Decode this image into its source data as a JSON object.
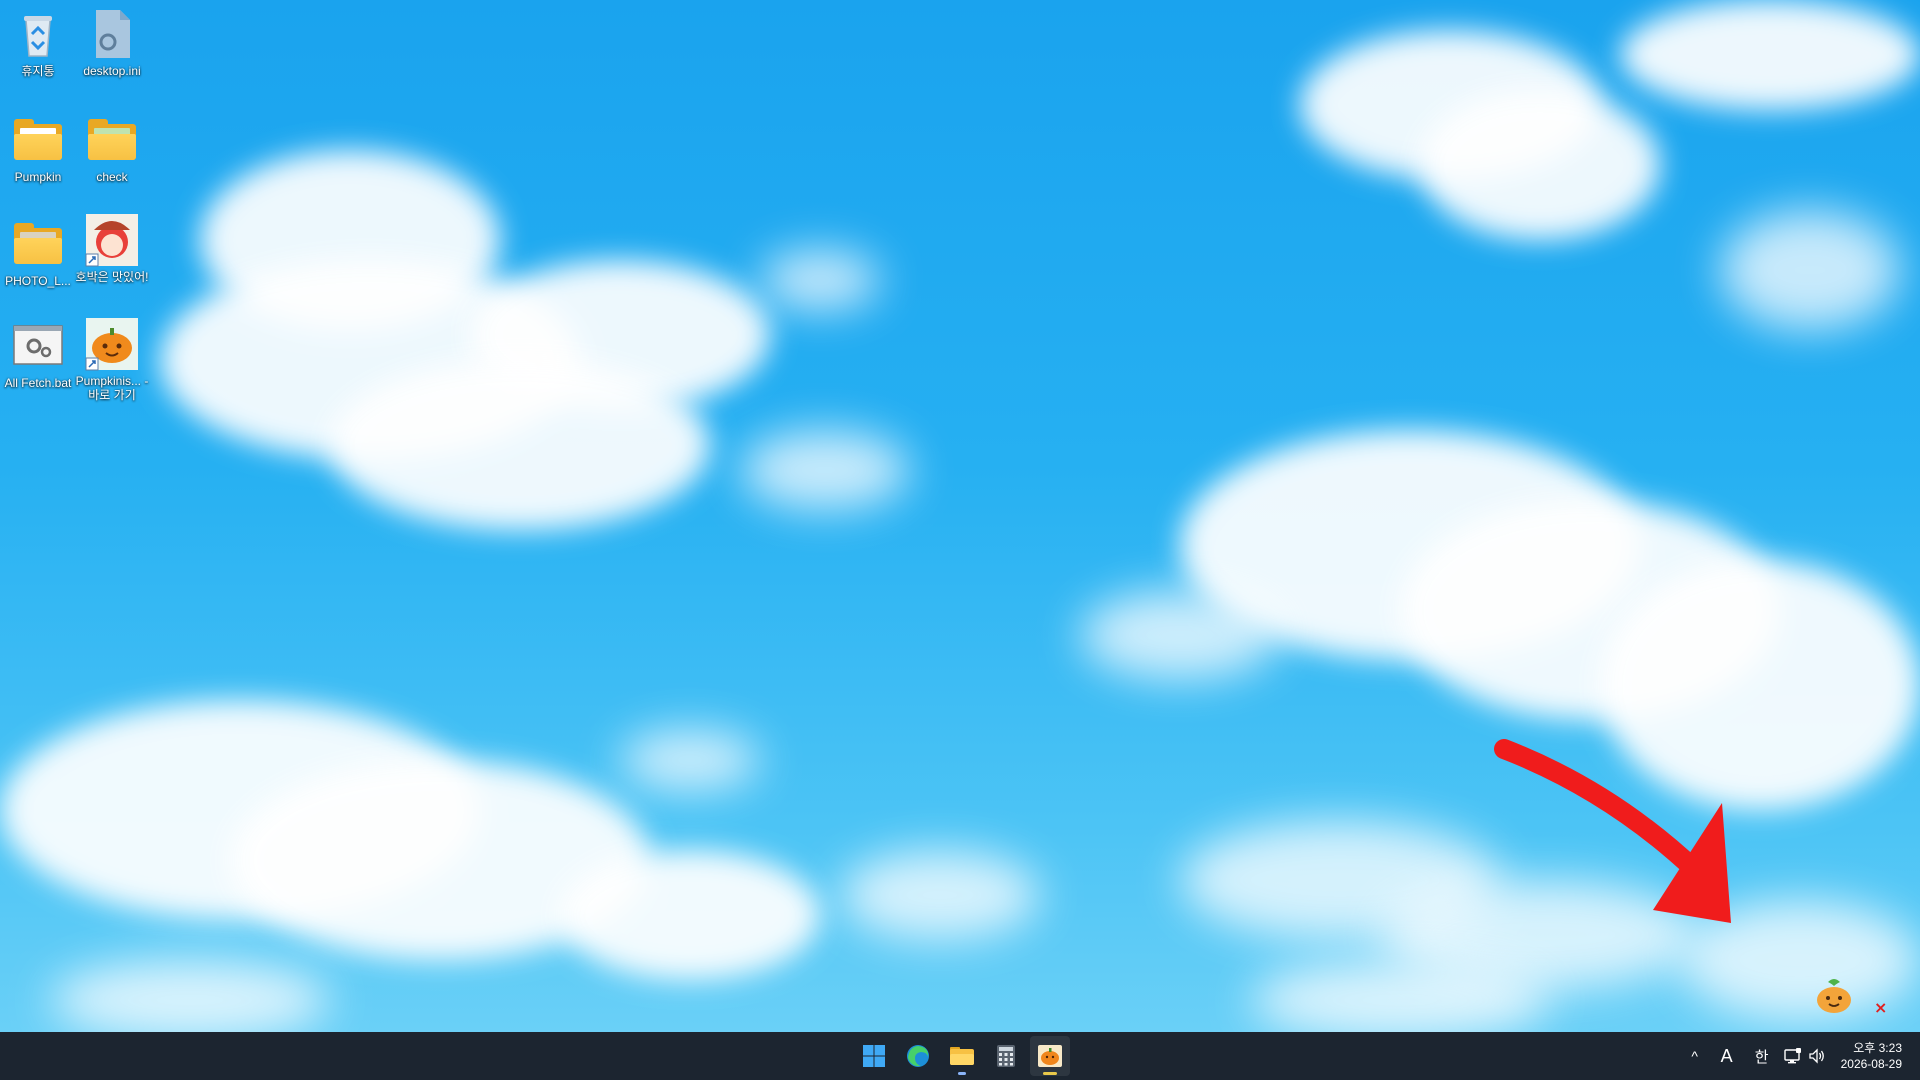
{
  "desktop": {
    "icons": [
      {
        "label": "휴지통",
        "icon": "recycle-bin-icon"
      },
      {
        "label": "desktop.ini",
        "icon": "settings-file-icon"
      },
      {
        "label": "Pumpkin",
        "icon": "folder-icon"
      },
      {
        "label": "check",
        "icon": "folder-icon"
      },
      {
        "label": "PHOTO_L...",
        "icon": "folder-icon"
      },
      {
        "label": "호박은 맛있어!",
        "icon": "anime-girl-shortcut-icon"
      },
      {
        "label": "All Fetch.bat",
        "icon": "batch-file-icon"
      },
      {
        "label": "Pumpkinis... - 바로 가기",
        "icon": "pumpkin-shortcut-icon"
      }
    ]
  },
  "overlay": {
    "arrow_color": "#f01c1c",
    "widget_icon": "pumpkin-mascot-icon",
    "close_glyph": "×"
  },
  "taskbar": {
    "apps": [
      {
        "name": "start",
        "icon": "windows-logo-icon"
      },
      {
        "name": "edge",
        "icon": "edge-icon"
      },
      {
        "name": "file-explorer",
        "icon": "folder-icon"
      },
      {
        "name": "calculator",
        "icon": "calculator-icon"
      },
      {
        "name": "pumpkin-app",
        "icon": "pumpkin-icon"
      }
    ],
    "tray": {
      "chevron": "^",
      "ime_mode": "A",
      "ime_lang": "한",
      "time": "오후 3:23",
      "date": "2026-08-29"
    }
  },
  "colors": {
    "sky": "#1aa3ee",
    "taskbar": "#1c2530",
    "folder": "#f7c143"
  }
}
